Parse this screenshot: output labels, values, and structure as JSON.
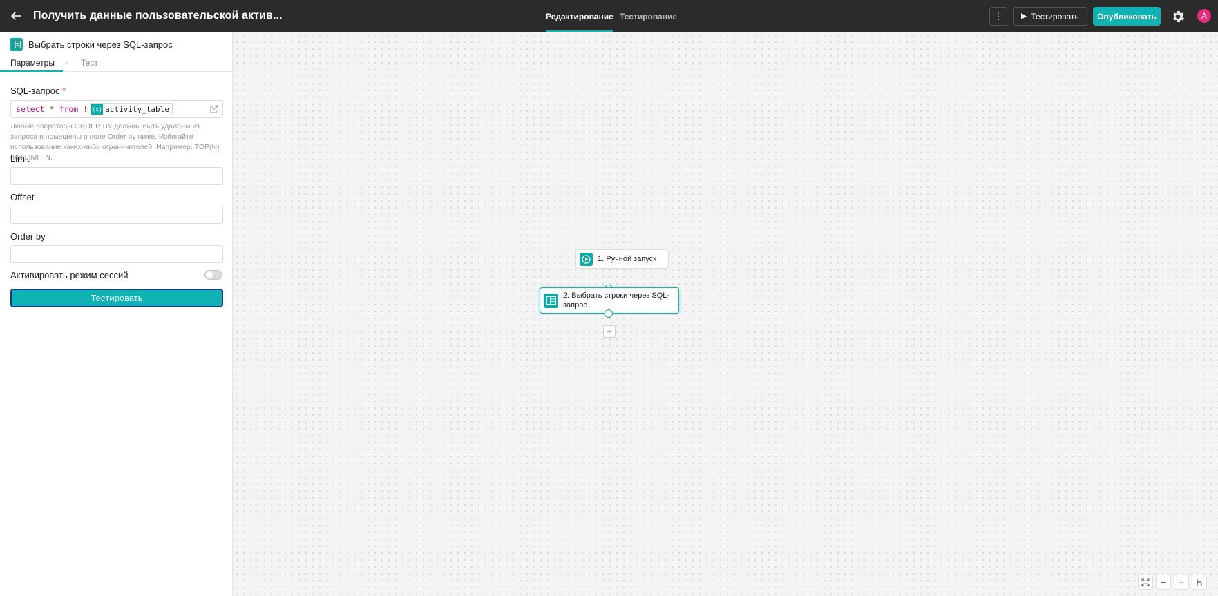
{
  "header": {
    "title": "Получить данные пользовательской актив...",
    "tabs": [
      {
        "label": "Редактирование",
        "active": true
      },
      {
        "label": "Тестирование",
        "active": false
      }
    ],
    "more_label": "⋮",
    "test_label": "Тестировать",
    "publish_label": "Опубликовать",
    "avatar_letter": "A",
    "colors": {
      "bar": "#2b2b2b",
      "accent": "#10b3b3",
      "avatar": "#e52c7e"
    }
  },
  "panel": {
    "title": "Выбрать строки через SQL-запрос",
    "tabs": [
      {
        "label": "Параметры",
        "active": true
      },
      {
        "label": "Тест",
        "active": false
      }
    ],
    "sql": {
      "label": "SQL-запрос",
      "required_mark": "*",
      "kw_select": "select",
      "star": "*",
      "kw_from": "from",
      "bang": "!",
      "var_icon": "(x)",
      "variable": "activity_table",
      "hint": "Любые операторы ORDER BY должны быть удалены из запроса и помещены в поле Order by ниже. Избегайте использование каких-либо ограничителей. Например: TOP(N) или LIMIT N."
    },
    "limit": {
      "label": "Limit",
      "value": ""
    },
    "offset": {
      "label": "Offset",
      "value": ""
    },
    "order_by": {
      "label": "Order by",
      "value": ""
    },
    "session_mode": {
      "label": "Активировать режим сессий",
      "enabled": false
    },
    "run_label": "Тестировать"
  },
  "canvas": {
    "nodes": [
      {
        "label": "1. Ручной запуск",
        "icon": "play-circle-icon"
      },
      {
        "label": "2. Выбрать строки через SQL-запрос",
        "icon": "table-icon",
        "selected": true
      }
    ],
    "add_label": "+",
    "zoom_minus": "−",
    "zoom_plus": "+"
  }
}
